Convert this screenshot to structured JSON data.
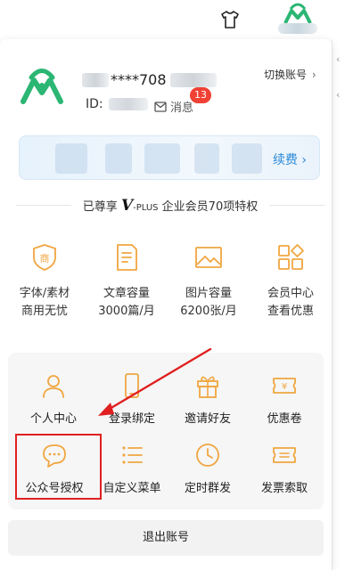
{
  "header": {
    "shirt_icon": "tshirt-icon",
    "avatar_icon": "logo-icon"
  },
  "account": {
    "name_visible": "****708",
    "id_label": "ID:",
    "message_label": "消息",
    "message_count": "13",
    "switch_label": "切换账号",
    "switch_chevron": "›"
  },
  "renew": {
    "link_label": "续费 ›"
  },
  "privilege": {
    "prefix": "已尊享",
    "brand_v": "V",
    "brand_plus": "-PLUS",
    "suffix": "企业会员70项特权"
  },
  "benefits": [
    {
      "icon": "shield-shang-icon",
      "line1": "字体/素材",
      "line2": "商用无忧"
    },
    {
      "icon": "document-icon",
      "line1": "文章容量",
      "line2": "3000篇/月"
    },
    {
      "icon": "image-icon",
      "line1": "图片容量",
      "line2": "6200张/月"
    },
    {
      "icon": "grid-icon",
      "line1": "会员中心",
      "line2": "查看优惠"
    }
  ],
  "tools": [
    {
      "icon": "user-icon",
      "label": "个人中心"
    },
    {
      "icon": "phone-icon",
      "label": "登录绑定"
    },
    {
      "icon": "gift-icon",
      "label": "邀请好友"
    },
    {
      "icon": "coupon-icon",
      "label": "优惠卷"
    },
    {
      "icon": "chat-icon",
      "label": "公众号授权"
    },
    {
      "icon": "list-icon",
      "label": "自定义菜单"
    },
    {
      "icon": "clock-icon",
      "label": "定时群发"
    },
    {
      "icon": "invoice-icon",
      "label": "发票索取"
    }
  ],
  "logout": {
    "label": "退出账号"
  },
  "colors": {
    "accent": "#f0a640",
    "brand_green": "#2bb673",
    "badge": "#f04134",
    "link": "#2a8ad9",
    "annotation": "#e02020"
  }
}
